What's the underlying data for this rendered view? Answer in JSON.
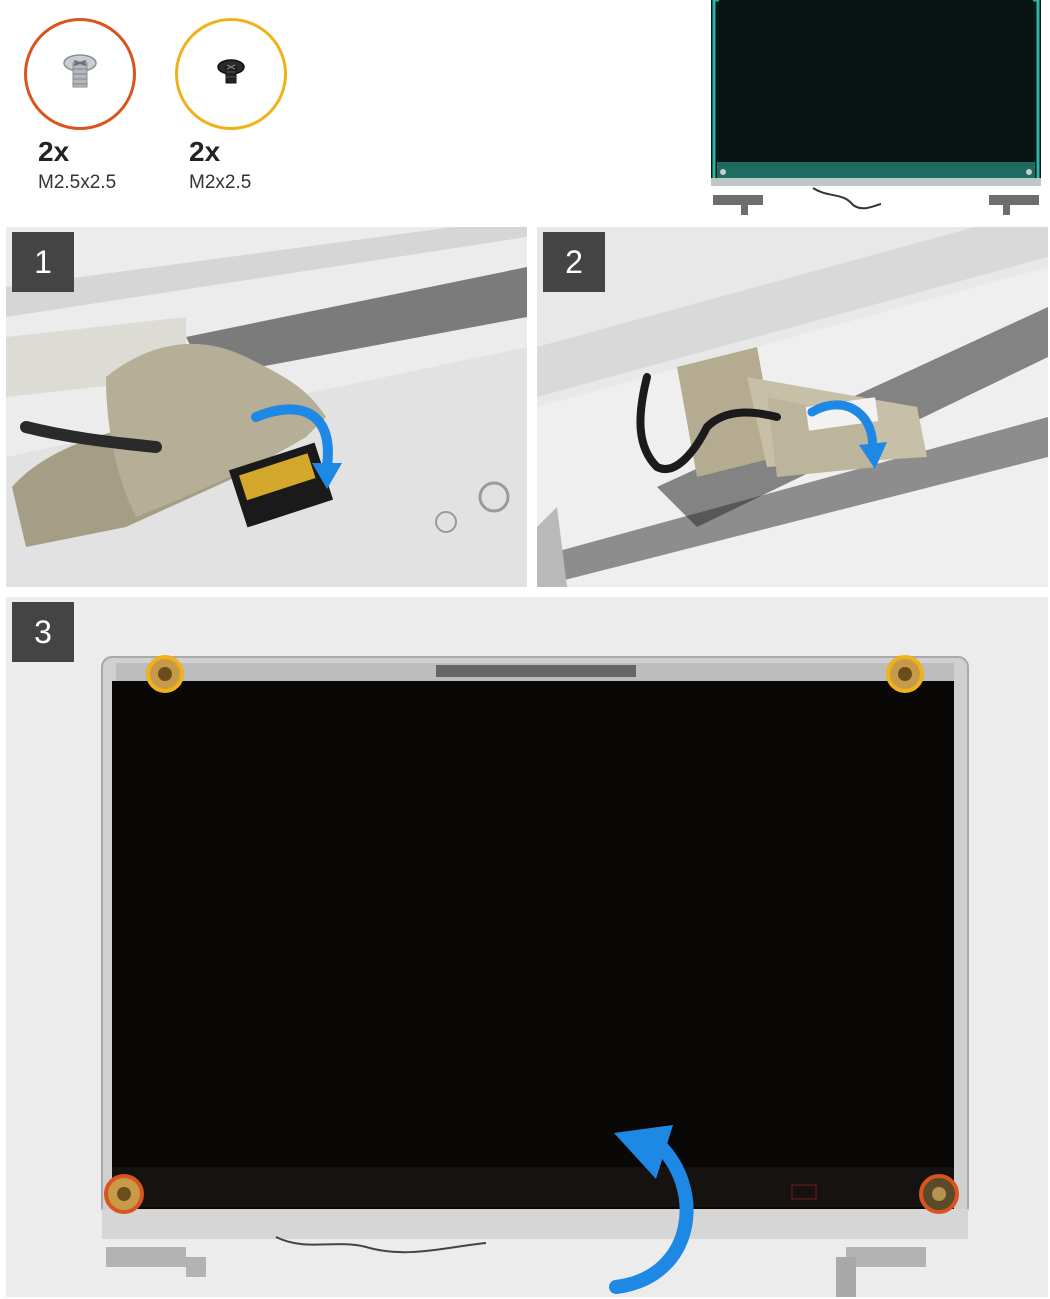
{
  "screws": [
    {
      "count": "2x",
      "size": "M2.5x2.5",
      "ring_color": "#d9541e",
      "type": "silver"
    },
    {
      "count": "2x",
      "size": "M2x2.5",
      "ring_color": "#f0b21a",
      "type": "black"
    }
  ],
  "steps": [
    {
      "number": "1"
    },
    {
      "number": "2"
    },
    {
      "number": "3"
    }
  ],
  "arrow_color": "#1e88e5"
}
